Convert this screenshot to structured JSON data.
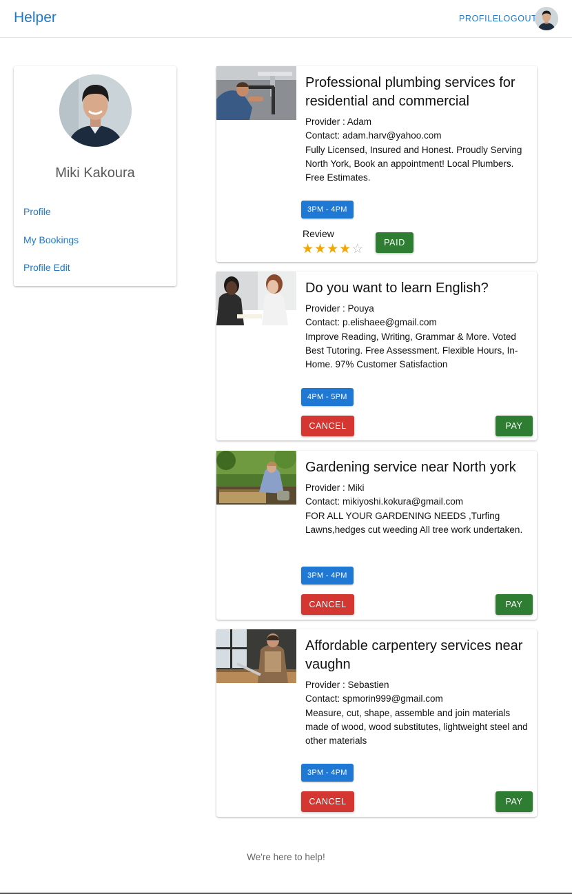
{
  "header": {
    "brand": "Helper",
    "nav_profile": "PROFILE",
    "nav_logout": "LOGOUT",
    "avatar_icon": "user-avatar"
  },
  "sidebar": {
    "name": "Miki Kakoura",
    "links": [
      {
        "label": "Profile"
      },
      {
        "label": "My Bookings"
      },
      {
        "label": "Profile Edit"
      }
    ]
  },
  "bookings": [
    {
      "image": "plumbing-photo",
      "title": "Professional plumbing services for residential and commercial",
      "provider": "Provider : Adam",
      "contact": "Contact: adam.harv@yahoo.com",
      "description": "Fully Licensed, Insured and Honest. Proudly Serving North York, Book an appointment! Local Plumbers. Free Estimates.",
      "time_slot": "3PM - 4PM",
      "review_label": "Review",
      "rating": 4,
      "rating_max": 5,
      "status_label": "PAID"
    },
    {
      "image": "tutoring-photo",
      "title": "Do you want to learn English?",
      "provider": "Provider : Pouya",
      "contact": "Contact: p.elishaee@gmail.com",
      "description": "Improve Reading, Writing, Grammar & More. Voted Best Tutoring. Free Assessment. Flexible Hours, In-Home. 97% Customer Satisfaction",
      "time_slot": "4PM - 5PM",
      "cancel_label": "CANCEL",
      "pay_label": "PAY"
    },
    {
      "image": "gardening-photo",
      "title": "Gardening service near North york",
      "provider": "Provider : Miki",
      "contact": "Contact: mikiyoshi.kokura@gmail.com",
      "description": "FOR ALL YOUR GARDENING NEEDS ,Turfing Lawns,hedges cut weeding All tree work undertaken.",
      "time_slot": "3PM - 4PM",
      "cancel_label": "CANCEL",
      "pay_label": "PAY"
    },
    {
      "image": "carpentry-photo",
      "title": "Affordable carpentery services near vaughn",
      "provider": "Provider : Sebastien",
      "contact": "Contact: spmorin999@gmail.com",
      "description": "Measure, cut, shape, assemble and join materials made of wood, wood substitutes, lightweight steel and other materials",
      "time_slot": "3PM - 4PM",
      "cancel_label": "CANCEL",
      "pay_label": "PAY"
    }
  ],
  "footer": {
    "text": "We're here to help!"
  },
  "colors": {
    "accent": "#1e78c8",
    "chip": "#1e78d4",
    "cancel": "#d43632",
    "pay": "#2e7d32",
    "star": "#f5a700"
  }
}
